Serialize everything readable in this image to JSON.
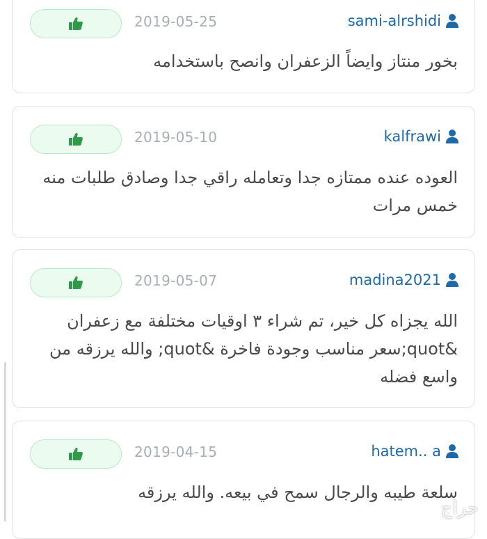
{
  "reviews": [
    {
      "user": "sami-alrshidi",
      "date": "2019-05-25",
      "text": "بخور منتاز وايضاً الزعفران وانصح باستخدامه"
    },
    {
      "user": "kalfrawi",
      "date": "2019-05-10",
      "text": "العوده عنده ممتازه جدا وتعامله راقي جدا وصادق طلبات منه خمس مرات"
    },
    {
      "user": "madina2021",
      "date": "2019-05-07",
      "text": "الله يجزاه كل خير، تم شراء ٣ اوقيات مختلفة مع زعفران &quot;سعر مناسب وجودة فاخرة &quot;  والله يرزقه من واسع فضله"
    },
    {
      "user": "hatem.. a",
      "date": "2019-04-15",
      "text": "سلعة طيبه والرجال سمح في بيعه.    والله يرزقه"
    }
  ],
  "icons": {
    "like": "thumbs-up-icon",
    "user": "user-icon"
  },
  "colors": {
    "username": "#1e6aa8",
    "like_icon": "#2e9a4a",
    "like_bg": "#ecfbef",
    "date": "#a6aeb8"
  },
  "watermark": "حراج"
}
